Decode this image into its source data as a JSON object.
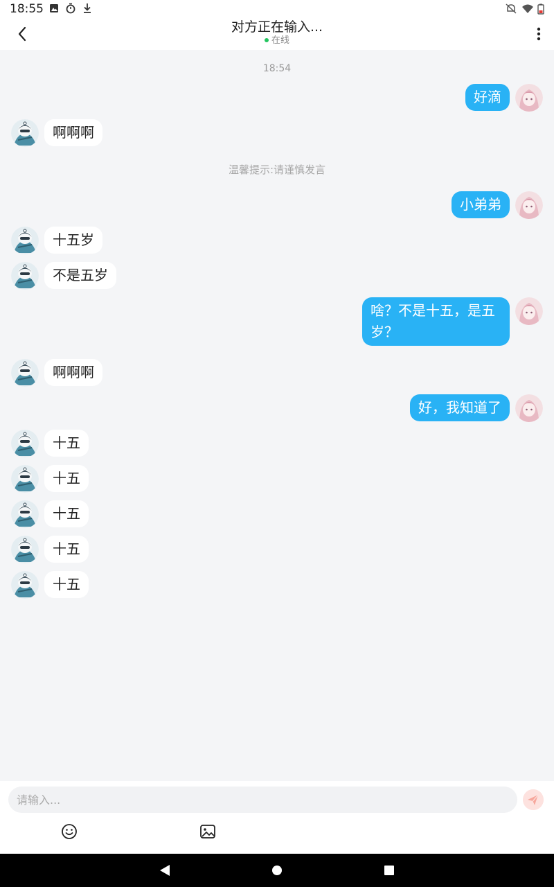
{
  "status_bar": {
    "time": "18:55",
    "left_icons": [
      "image-icon",
      "timer-icon",
      "download-icon"
    ],
    "right_icons": [
      "bell-off-icon",
      "wifi-icon",
      "battery-low-icon"
    ]
  },
  "header": {
    "title": "对方正在输入...",
    "status": "在线",
    "status_color": "#22c55e",
    "back_icon": "chevron-left-icon",
    "more_icon": "more-vertical-icon"
  },
  "chat": {
    "time_label": "18:54",
    "tip": "温馨提示:请谨慎发言",
    "messages": [
      {
        "side": "right",
        "text": "好滴"
      },
      {
        "side": "left",
        "text": "啊啊啊"
      },
      {
        "side": "right",
        "text": "小弟弟"
      },
      {
        "side": "left",
        "text": "十五岁"
      },
      {
        "side": "left",
        "text": "不是五岁"
      },
      {
        "side": "right",
        "text": "啥？不是十五，是五岁？"
      },
      {
        "side": "left",
        "text": "啊啊啊"
      },
      {
        "side": "right",
        "text": "好，我知道了"
      },
      {
        "side": "left",
        "text": "十五"
      },
      {
        "side": "left",
        "text": "十五"
      },
      {
        "side": "left",
        "text": "十五"
      },
      {
        "side": "left",
        "text": "十五"
      },
      {
        "side": "left",
        "text": "十五"
      }
    ],
    "outgoing_color": "#29b2f5",
    "incoming_color": "#ffffff"
  },
  "input": {
    "placeholder": "请输入...",
    "value": "",
    "send_icon": "send-icon",
    "emoji_icon": "emoji-icon",
    "image_icon": "image-icon"
  },
  "nav_bar": {
    "icons": [
      "nav-back-icon",
      "nav-home-icon",
      "nav-recents-icon"
    ]
  }
}
